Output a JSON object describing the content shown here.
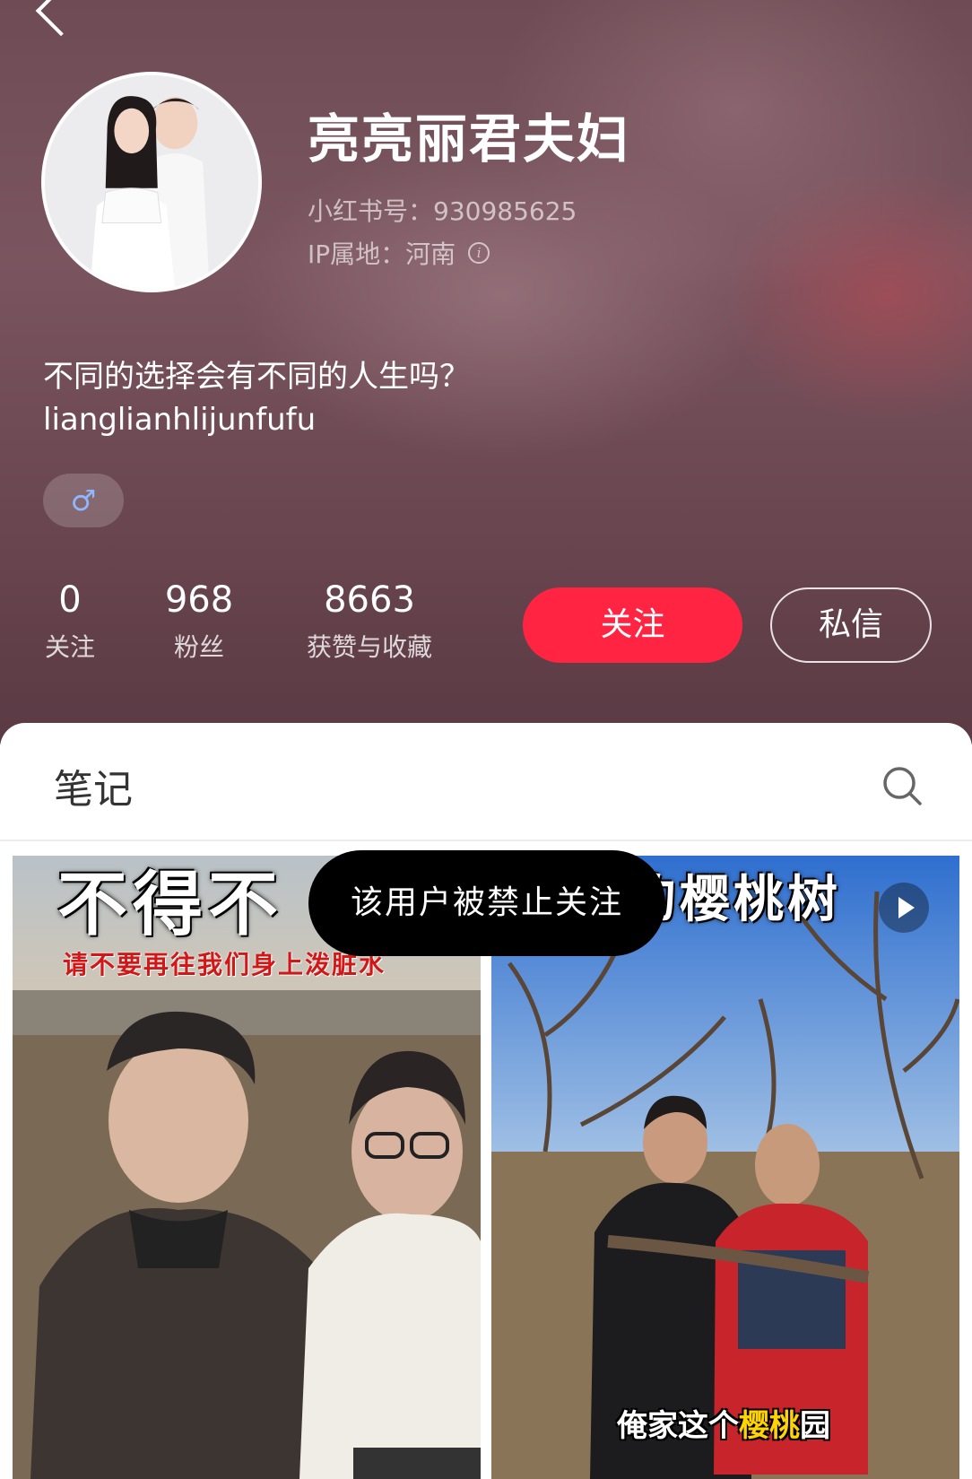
{
  "profile": {
    "nickname": "亮亮丽君夫妇",
    "id_line": "小红书号：930985625",
    "ip_line": "IP属地：河南",
    "bio": "不同的选择会有不同的人生吗？",
    "bio_sub": "lianglianhlijunfufu",
    "gender_symbol": "♂"
  },
  "stats": [
    {
      "value": "0",
      "label": "关注"
    },
    {
      "value": "968",
      "label": "粉丝"
    },
    {
      "value": "8663",
      "label": "获赞与收藏"
    }
  ],
  "actions": {
    "follow_label": "关注",
    "message_label": "私信"
  },
  "tabs": {
    "notes_label": "笔记"
  },
  "toast": "该用户被禁止关注",
  "cards": {
    "left": {
      "top_text": "不得不",
      "sub_text": "请不要再往我们身上泼脏水"
    },
    "right": {
      "top_text": "的樱桃树",
      "caption_pre": "俺家这个",
      "caption_highlight": "樱桃",
      "caption_post": "园"
    }
  },
  "colors": {
    "accent_red": "#ff2442",
    "toast_bg": "#000000"
  },
  "icons": [
    "back-arrow-icon",
    "info-icon",
    "gender-male-icon",
    "search-icon",
    "play-icon"
  ]
}
